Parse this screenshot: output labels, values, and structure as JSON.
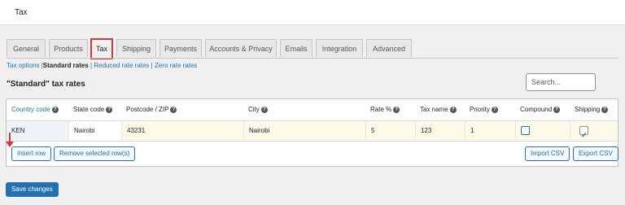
{
  "page": {
    "title": "Tax"
  },
  "tabs": [
    {
      "label": "General",
      "active": false
    },
    {
      "label": "Products",
      "active": false
    },
    {
      "label": "Tax",
      "active": true
    },
    {
      "label": "Shipping",
      "active": false
    },
    {
      "label": "Payments",
      "active": false
    },
    {
      "label": "Accounts & Privacy",
      "active": false
    },
    {
      "label": "Emails",
      "active": false
    },
    {
      "label": "Integration",
      "active": false
    },
    {
      "label": "Advanced",
      "active": false
    }
  ],
  "subnav": {
    "tax_options": "Tax options",
    "sep": "|",
    "standard": "Standard rates",
    "reduced": "Reduced rate rates",
    "zero": "Zero rate rates"
  },
  "rates": {
    "title": "\"Standard\" tax rates",
    "search_placeholder": "Search..."
  },
  "table": {
    "headers": [
      "Country code",
      "State code",
      "Postcode / ZIP",
      "City",
      "Rate %",
      "Tax name",
      "Priority",
      "Compound",
      "Shipping"
    ],
    "row": {
      "country": "KEN",
      "state": "Nairobi",
      "postcode": "43231",
      "city": "Nairobi",
      "rate": "5",
      "tax_name": "123",
      "priority": "1",
      "compound": false,
      "shipping": true
    }
  },
  "buttons": {
    "insert_row": "Insert row",
    "remove_rows": "Remove selected row(s)",
    "import_csv": "Import CSV",
    "export_csv": "Export CSV",
    "save": "Save changes"
  },
  "colors": {
    "accent": "#2271b1",
    "highlight": "#d63638",
    "row_bg": "#fcf9e8"
  }
}
